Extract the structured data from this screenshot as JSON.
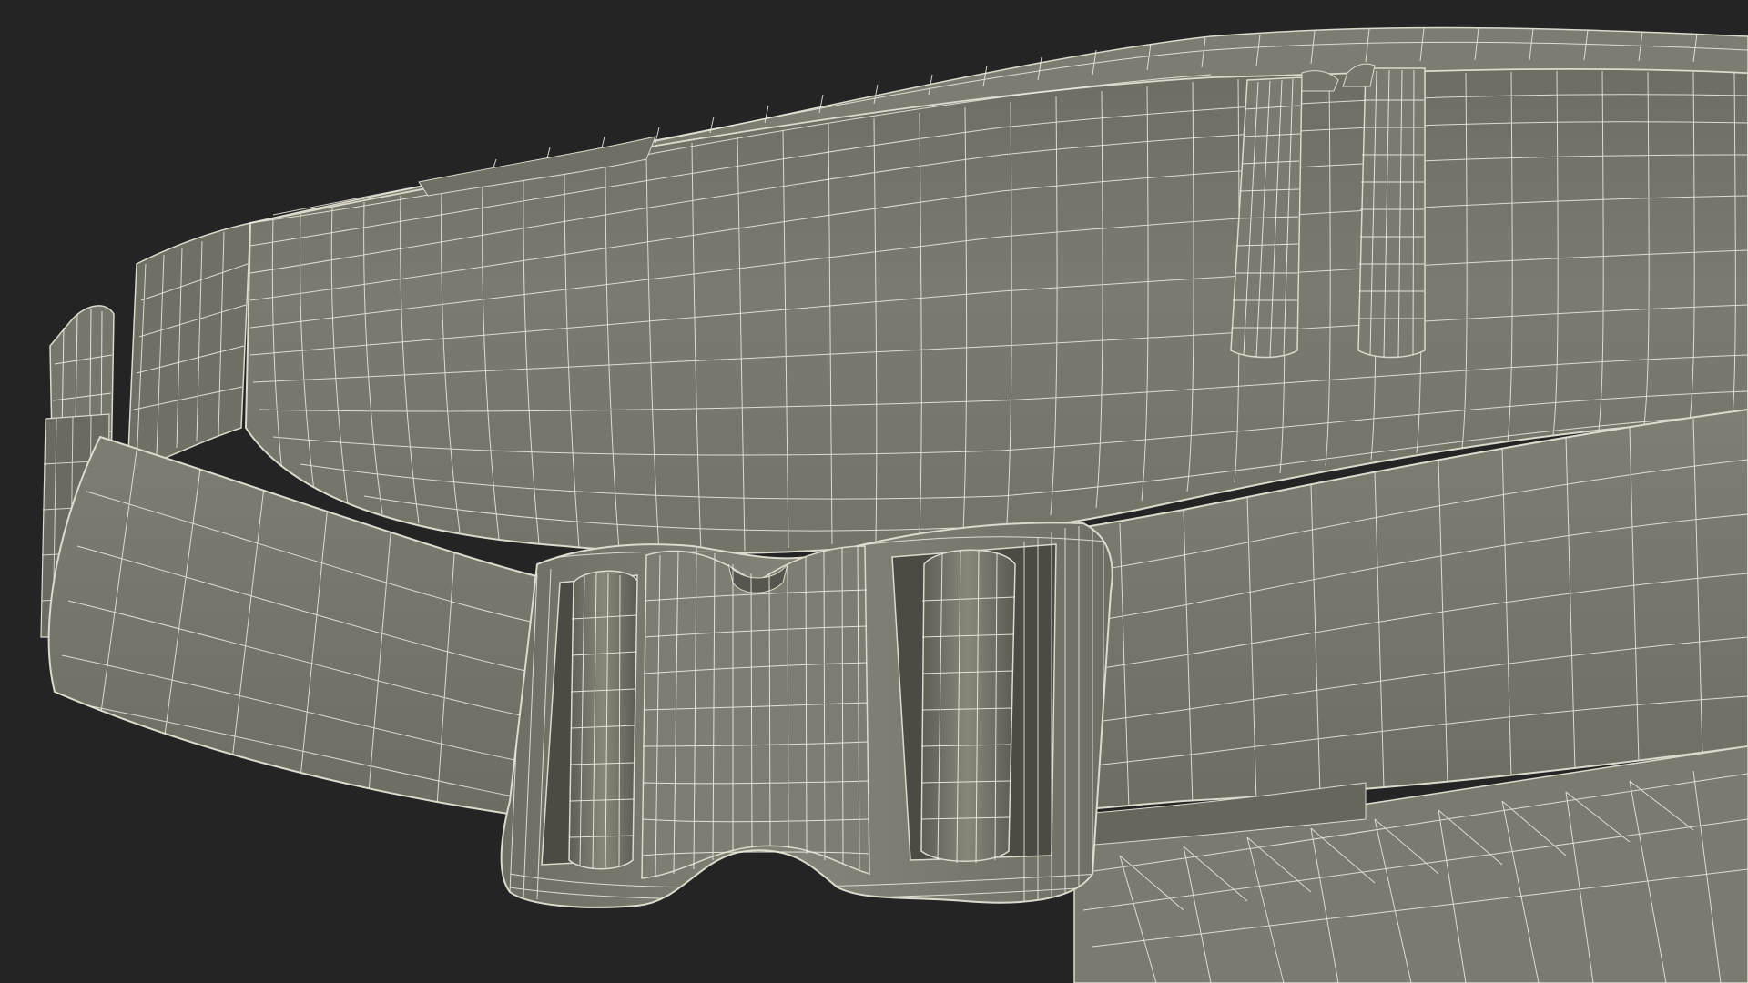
{
  "scene": {
    "subject": "wireframe-render-waist-belt-bag",
    "colors": {
      "background": "#242424",
      "surface": "#737367",
      "surface_shadow": "#5f5f55",
      "surface_light": "#84847a",
      "wire": "#f0eee4",
      "edge": "#dcdacc"
    }
  }
}
